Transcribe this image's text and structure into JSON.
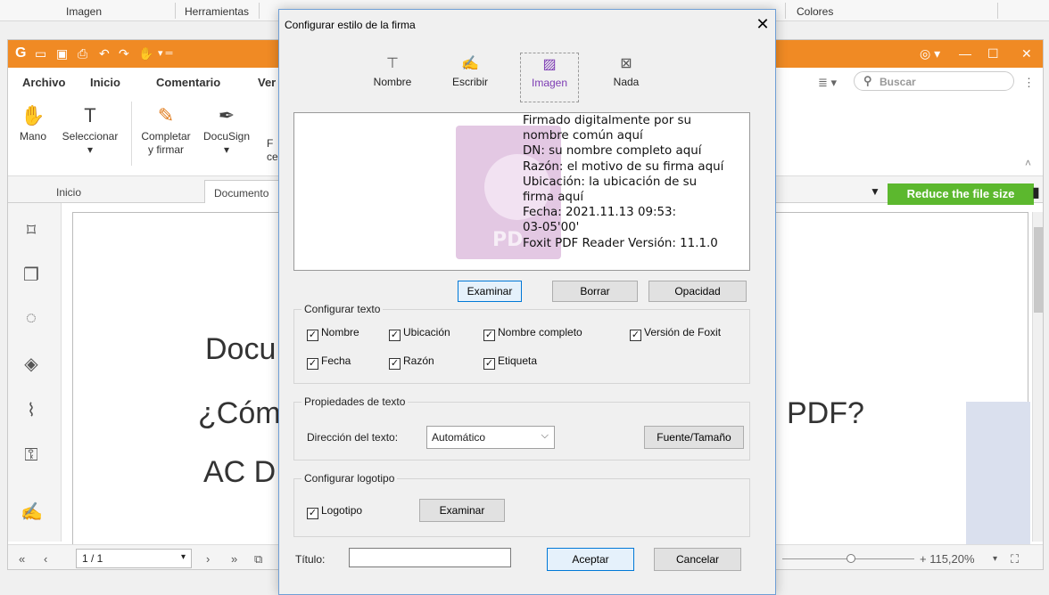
{
  "background_toolbar": {
    "items": [
      "Imagen",
      "Herramientas",
      "Colores"
    ]
  },
  "app": {
    "menu": [
      "Archivo",
      "Inicio",
      "Comentario",
      "Ver"
    ],
    "search_placeholder": "Buscar",
    "tools": {
      "hand": "Mano",
      "select": "Seleccionar",
      "fill_sign_1": "Completar",
      "fill_sign_2": "y firmar",
      "docusign": "DocuSign",
      "partial_1": "F",
      "partial_2": "ce"
    },
    "tabs": [
      "Inicio",
      "Documento"
    ],
    "compress_banner": "Reduce the file size",
    "page_lines": [
      "Docu",
      "¿Cóm",
      "AC D",
      "PDF?"
    ],
    "status": {
      "page": "1 / 1",
      "zoom": "+ 115,20%"
    },
    "brand_color": "#f08a24"
  },
  "dialog": {
    "title": "Configurar estilo de la firma",
    "types": [
      {
        "label": "Nombre",
        "icon": "text-icon"
      },
      {
        "label": "Escribir",
        "icon": "pen-icon"
      },
      {
        "label": "Imagen",
        "icon": "image-icon",
        "selected": true
      },
      {
        "label": "Nada",
        "icon": "no-image-icon"
      }
    ],
    "preview_lines": [
      "Firmado digitalmente por su",
      "nombre común aquí",
      "DN: su nombre completo aquí",
      "Razón: el motivo de su firma aquí",
      "Ubicación: la ubicación de su",
      "firma aquí",
      "Fecha: 2021.11.13 09:53:",
      "03-05'00'",
      "Foxit PDF Reader Versión: 11.1.0"
    ],
    "preview_logo_text": "PD",
    "buttons": {
      "browse": "Examinar",
      "clear": "Borrar",
      "opacity": "Opacidad"
    },
    "configure_text": {
      "label": "Configurar texto",
      "options": [
        {
          "label": "Nombre",
          "checked": true
        },
        {
          "label": "Ubicación",
          "checked": true
        },
        {
          "label": "Nombre completo",
          "checked": true
        },
        {
          "label": "Versión de Foxit",
          "checked": true
        },
        {
          "label": "Fecha",
          "checked": true
        },
        {
          "label": "Razón",
          "checked": true
        },
        {
          "label": "Etiqueta",
          "checked": true
        }
      ]
    },
    "text_props": {
      "label": "Propiedades de texto",
      "direction_label": "Dirección del texto:",
      "direction_value": "Automático",
      "font_button": "Fuente/Tamaño"
    },
    "logo": {
      "label": "Configurar logotipo",
      "checkbox": "Logotipo",
      "checked": true,
      "browse": "Examinar"
    },
    "title_label": "Título:",
    "title_value": "",
    "accept": "Aceptar",
    "cancel": "Cancelar",
    "accent_color": "#7c3bb3"
  }
}
